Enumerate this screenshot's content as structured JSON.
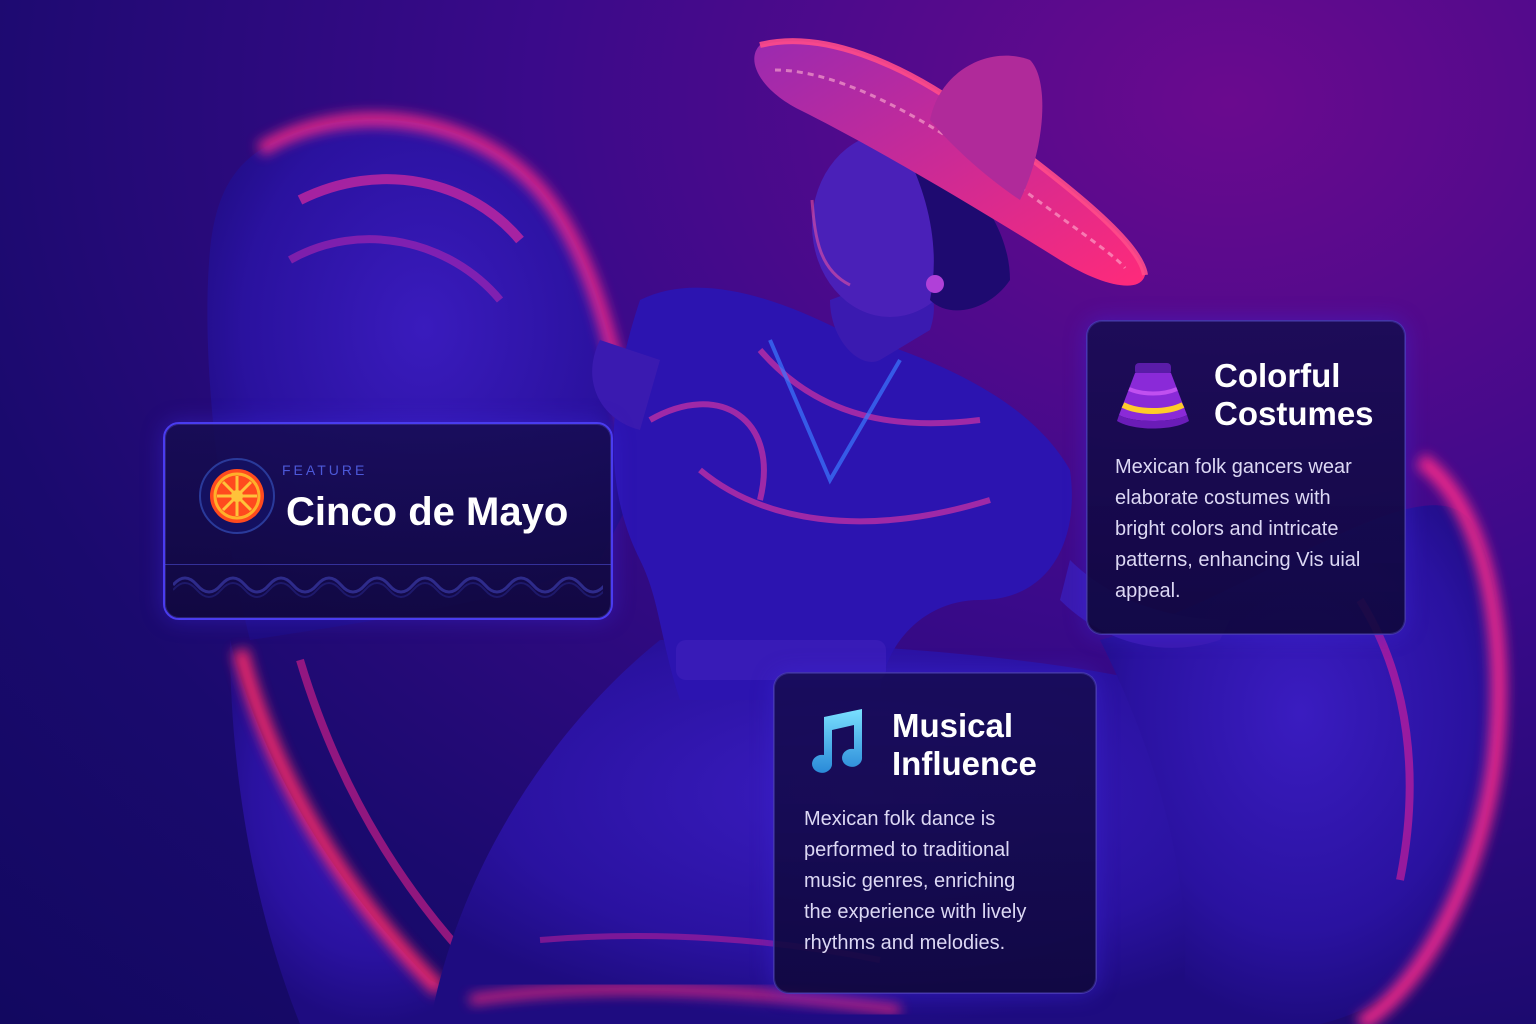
{
  "feature_card": {
    "kicker": "FEATURE",
    "title": "Cinco de Mayo",
    "icon": "wheel-emblem-icon"
  },
  "costumes_card": {
    "title_line1": "Colorful",
    "title_line2": "Costumes",
    "body_lines": [
      "Mexican folk gancers wear",
      "elaborate costumes with",
      "bright colors and intricate",
      "patterns, enhancing Vis uial",
      "appeal."
    ],
    "icon": "skirt-icon"
  },
  "music_card": {
    "title_line1": "Musical",
    "title_line2": "Influence",
    "body_lines": [
      "Mexican folk dance is",
      "performed to traditional",
      "music genres, enriching",
      "the experience with lively",
      "rhythms and melodies."
    ],
    "icon": "music-note-icon"
  },
  "colors": {
    "accent_blue": "#4a3cf0",
    "magenta_glow": "#ff2a8a",
    "background_deep": "#1a0a6e"
  }
}
